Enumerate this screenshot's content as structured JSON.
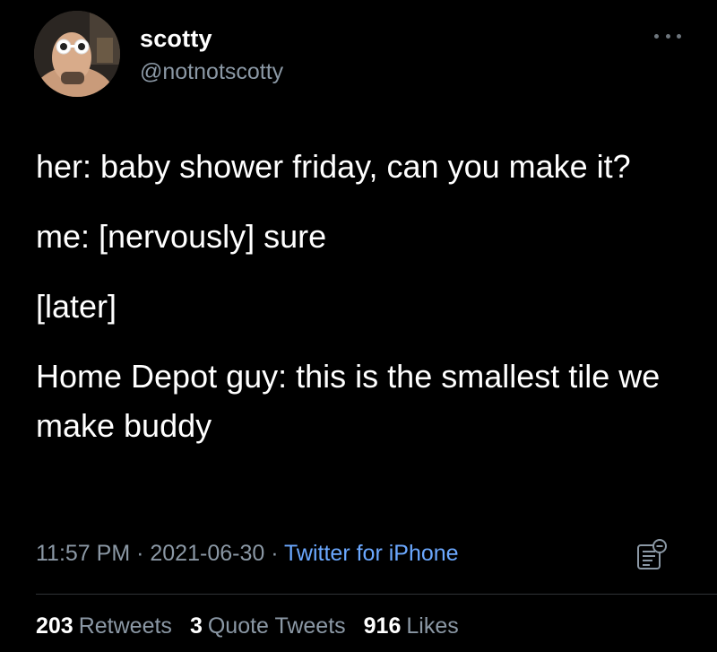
{
  "author": {
    "display_name": "scotty",
    "handle": "@notnotscotty"
  },
  "more_icon": "more-horizontal-icon",
  "tweet": {
    "paragraphs": [
      "her: baby shower friday, can you make it?",
      "me: [nervously] sure",
      "[later]",
      "Home Depot guy: this is the smallest tile we make buddy"
    ]
  },
  "meta": {
    "time": "11:57 PM",
    "separator": " · ",
    "date": "2021-06-30",
    "source": "Twitter for iPhone"
  },
  "analytics_icon": "analytics-icon",
  "stats": {
    "retweets": {
      "count": "203",
      "label": "Retweets"
    },
    "quote_tweets": {
      "count": "3",
      "label": "Quote Tweets"
    },
    "likes": {
      "count": "916",
      "label": "Likes"
    }
  },
  "colors": {
    "background": "#000000",
    "text_primary": "#ffffff",
    "text_secondary": "#8b98a5",
    "link": "#6ba8ff",
    "divider": "#2f3336"
  }
}
